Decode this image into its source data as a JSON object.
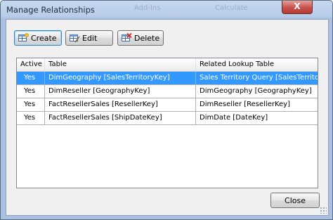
{
  "window": {
    "title": "Manage Relationships",
    "ghost_text_1": "Add-Ins",
    "ghost_text_2": "Calculate",
    "close_glyph": "X"
  },
  "toolbar": {
    "create_label": "Create",
    "edit_label": "Edit",
    "delete_label": "Delete"
  },
  "grid": {
    "columns": [
      "Active",
      "Table",
      "Related Lookup Table"
    ],
    "rows": [
      {
        "active": "Yes",
        "table": "DimGeography [SalesTerritoryKey]",
        "related": "Sales Territory Query [SalesTerritoryKey]",
        "selected": true
      },
      {
        "active": "Yes",
        "table": "DimReseller [GeographyKey]",
        "related": "DimGeography [GeographyKey]",
        "selected": false
      },
      {
        "active": "Yes",
        "table": "FactResellerSales [ResellerKey]",
        "related": "DimReseller [ResellerKey]",
        "selected": false
      },
      {
        "active": "Yes",
        "table": "FactResellerSales [ShipDateKey]",
        "related": "DimDate [DateKey]",
        "selected": false
      }
    ]
  },
  "footer": {
    "close_label": "Close"
  },
  "icons": {
    "create": "create-table-icon",
    "edit": "edit-table-icon",
    "delete": "delete-table-icon",
    "close": "close-icon"
  },
  "colors": {
    "selection": "#3399ff",
    "title_bar": "#b8cde9",
    "close_button": "#c75050"
  }
}
